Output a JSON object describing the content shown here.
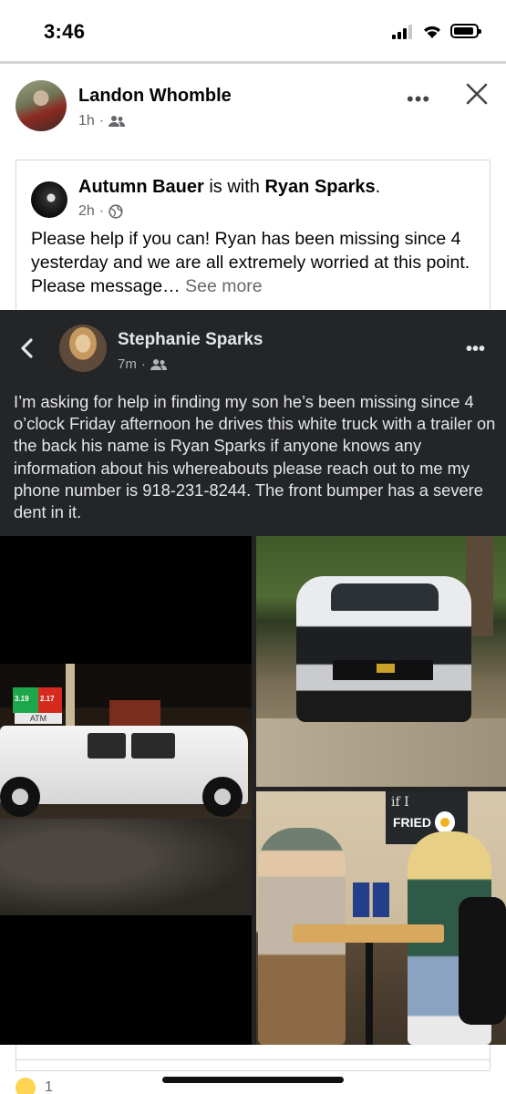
{
  "status_bar": {
    "time": "3:46",
    "battery_level": 0.85,
    "signal_bars": 3
  },
  "post": {
    "author": "Landon Whomble",
    "time": "1h",
    "audience_icon": "friends-icon",
    "more_icon": "more-options-icon",
    "close_icon": "close-icon"
  },
  "shared": {
    "author": "Autumn Bauer",
    "connector": " is with ",
    "tagged": "Ryan Sparks",
    "period": ".",
    "time": "2h",
    "audience_icon": "globe-icon",
    "text": "Please help if you can! Ryan has been missing since 4 yesterday and we are all extremely worried at this point. Please message… ",
    "see_more": "See more"
  },
  "screenshot": {
    "author": "Stephanie Sparks",
    "time": "7m",
    "audience_icon": "friends-icon",
    "text": "I’m asking for help in finding my son he’s been missing since 4 o’clock Friday afternoon he drives this white truck with a trailer on the back his name is Ryan Sparks if anyone knows any information about his whereabouts please reach out to me my phone number is 918-231-8244. The front bumper has a severe dent in it."
  },
  "photos": {
    "gas_price_1": "3.19",
    "gas_price_2": "2.17",
    "gas_atm": "ATM",
    "cafe_board_line1": "if I",
    "cafe_board_line2": "FRIED"
  },
  "reactions": {
    "count": "1",
    "emoji_icon": "care-emoji-icon"
  },
  "colors": {
    "dark_panel": "#242526",
    "secondary_text": "#65676b",
    "divider": "#d4d6da"
  }
}
